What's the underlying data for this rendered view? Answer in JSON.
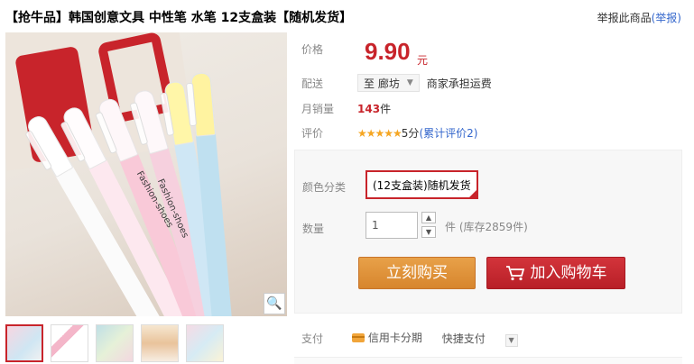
{
  "header": {
    "title": "【抢牛品】韩国创意文具 中性笔 水笔 12支盒装【随机发货】",
    "report_text": "举报此商品",
    "report_link": "(举报)"
  },
  "product": {
    "price_label": "价格",
    "price": "9.90",
    "price_unit": "元",
    "ship_label": "配送",
    "ship_to": "至 廊坊",
    "ship_note": "商家承担运费",
    "sales_label": "月销量",
    "sales": "143",
    "sales_unit": "件",
    "rating_label": "评价",
    "rating_stars": "★★★★★",
    "rating_score": "5分",
    "rating_link": "(累计评价2)"
  },
  "options": {
    "color_label": "颜色分类",
    "color_value": "(12支盒装)随机发货",
    "qty_label": "数量",
    "qty_value": "1",
    "qty_unit": "件",
    "stock": "(库存2859件)",
    "buy_label": "立刻购买",
    "cart_label": "加入购物车"
  },
  "payment": {
    "label": "支付",
    "method1": "信用卡分期",
    "method2": "快捷支付"
  },
  "gallery": {
    "pen_text": "Fashion-shoes",
    "thumbs": 5
  },
  "colors": {
    "accent_red": "#c8242b",
    "buy_orange": "#dc8c35",
    "link_blue": "#3366cc"
  }
}
